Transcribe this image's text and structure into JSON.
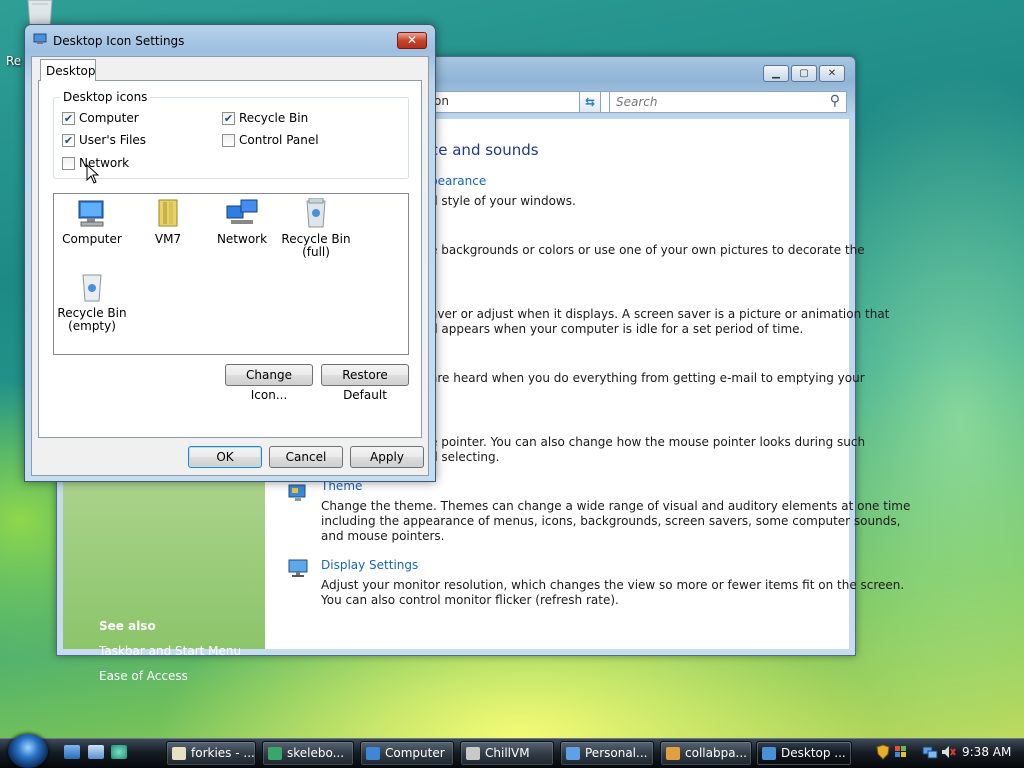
{
  "desktop": {
    "recycle_label": "Re"
  },
  "personalization": {
    "address_text": "on",
    "search_placeholder": "Search",
    "heading": "ce and sounds",
    "links": {
      "appearance": "pearance",
      "theme": "Theme",
      "display": "Display Settings"
    },
    "texts": {
      "appearance": "d style of your windows.",
      "background_1": "e backgrounds or colors or use one of your own pictures to decorate the",
      "screensaver_1": "aver or adjust when it displays. A screen saver is a picture or animation that",
      "screensaver_2": "d appears when your computer is idle for a set period of time.",
      "sounds_1": "are heard when you do everything from getting e-mail to emptying your",
      "mouse_1": "e pointer. You can also change how the mouse pointer looks during such",
      "mouse_2": "d selecting.",
      "theme_1": "Change the theme. Themes can change a wide range of visual and auditory elements at one time",
      "theme_2": "including the appearance of menus, icons, backgrounds, screen savers, some computer sounds,",
      "theme_3": "and mouse pointers.",
      "display_1": "Adjust your monitor resolution, which changes the view so more or fewer items fit on the screen.",
      "display_2": "You can also control monitor flicker (refresh rate)."
    },
    "sidebar": {
      "see_also": "See also",
      "items": [
        "Taskbar and Start Menu",
        "Ease of Access"
      ]
    }
  },
  "dialog": {
    "title": "Desktop Icon Settings",
    "close": "✕",
    "tab": "Desktop",
    "group_label": "Desktop icons",
    "checkboxes": [
      {
        "label": "Computer",
        "checked": true
      },
      {
        "label": "Recycle Bin",
        "checked": true
      },
      {
        "label": "User's Files",
        "checked": true
      },
      {
        "label": "Control Panel",
        "checked": false
      },
      {
        "label": "Network",
        "checked": false
      }
    ],
    "icons": [
      {
        "line1": "Computer",
        "line2": ""
      },
      {
        "line1": "VM7",
        "line2": ""
      },
      {
        "line1": "Network",
        "line2": ""
      },
      {
        "line1": "Recycle Bin",
        "line2": "(full)"
      },
      {
        "line1": "Recycle Bin",
        "line2": "(empty)"
      }
    ],
    "buttons": {
      "change_icon": "Change Icon...",
      "restore_default": "Restore Default",
      "ok": "OK",
      "cancel": "Cancel",
      "apply": "Apply"
    }
  },
  "taskbar": {
    "items": [
      "forkies - ...",
      "skelebo...",
      "Computer",
      "ChillVM",
      "Personal...",
      "collabpa...",
      "Desktop ..."
    ],
    "active_index": 6,
    "clock": "9:38 AM"
  },
  "colors": {
    "link": "#1565c0",
    "heading": "#1e3a8a",
    "close_button": "#c5462c"
  }
}
